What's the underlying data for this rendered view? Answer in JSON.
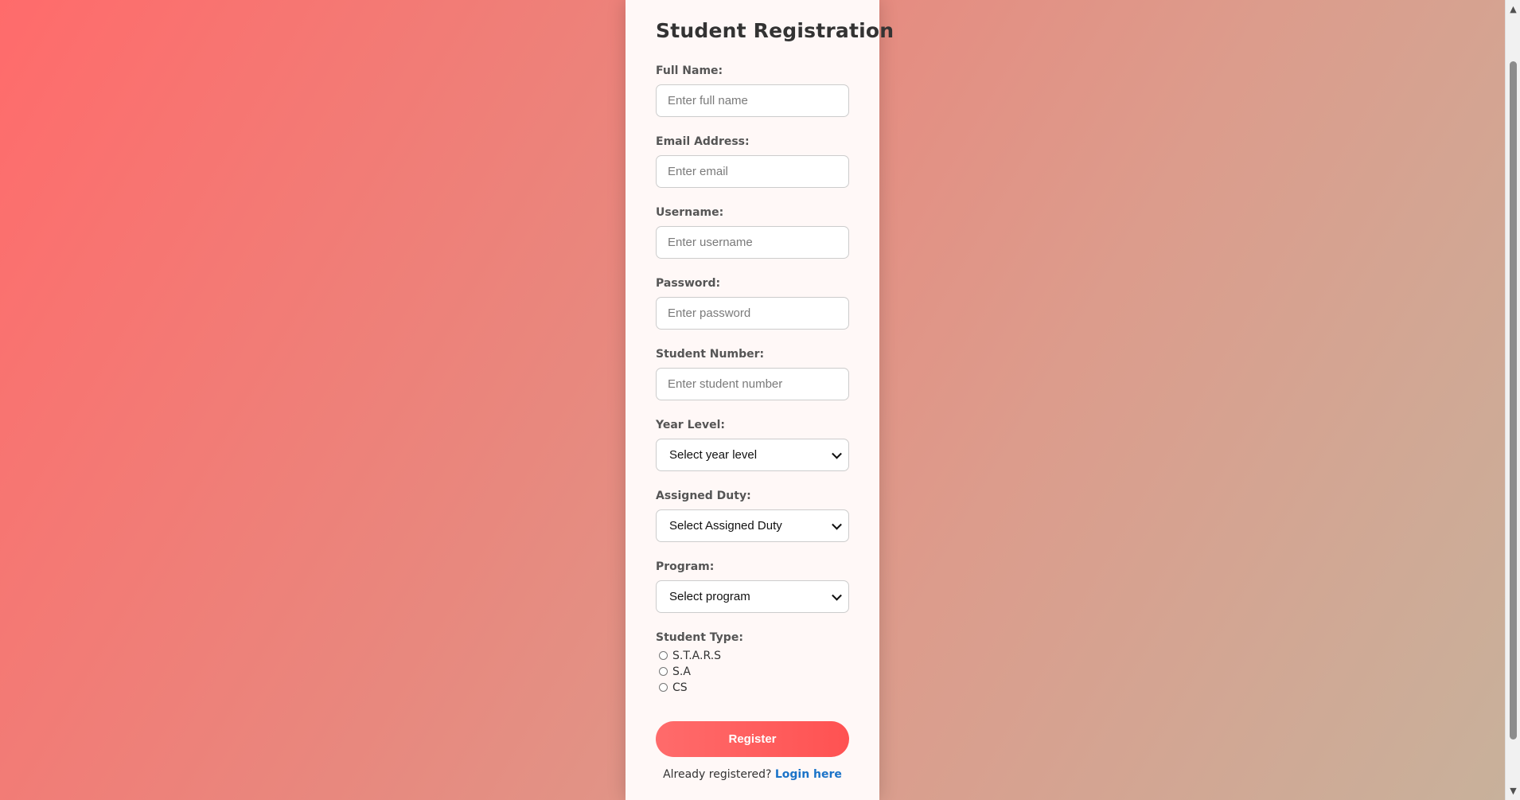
{
  "form": {
    "title": "Student Registration",
    "fields": [
      {
        "label": "Full Name:",
        "placeholder": "Enter full name",
        "value": ""
      },
      {
        "label": "Email Address:",
        "placeholder": "Enter email",
        "value": ""
      },
      {
        "label": "Username:",
        "placeholder": "Enter username",
        "value": ""
      },
      {
        "label": "Password:",
        "placeholder": "Enter password",
        "value": ""
      },
      {
        "label": "Student Number:",
        "placeholder": "Enter student number",
        "value": ""
      }
    ],
    "selects": [
      {
        "label": "Year Level:",
        "selected": "Select year level"
      },
      {
        "label": "Assigned Duty:",
        "selected": "Select Assigned Duty"
      },
      {
        "label": "Program:",
        "selected": "Select program"
      }
    ],
    "student_type": {
      "label": "Student Type:",
      "options": [
        "S.T.A.R.S",
        "S.A",
        "CS"
      ]
    },
    "register_label": "Register",
    "login_prompt": "Already registered?",
    "login_link": "Login here"
  },
  "colors": {
    "accent": "#ff5252",
    "link": "#1a73c8",
    "card_bg": "#fff8f7"
  },
  "icons": {
    "select_arrow": "chevron-down-icon",
    "scroll_up": "arrow-up-icon",
    "scroll_down": "arrow-down-icon"
  }
}
